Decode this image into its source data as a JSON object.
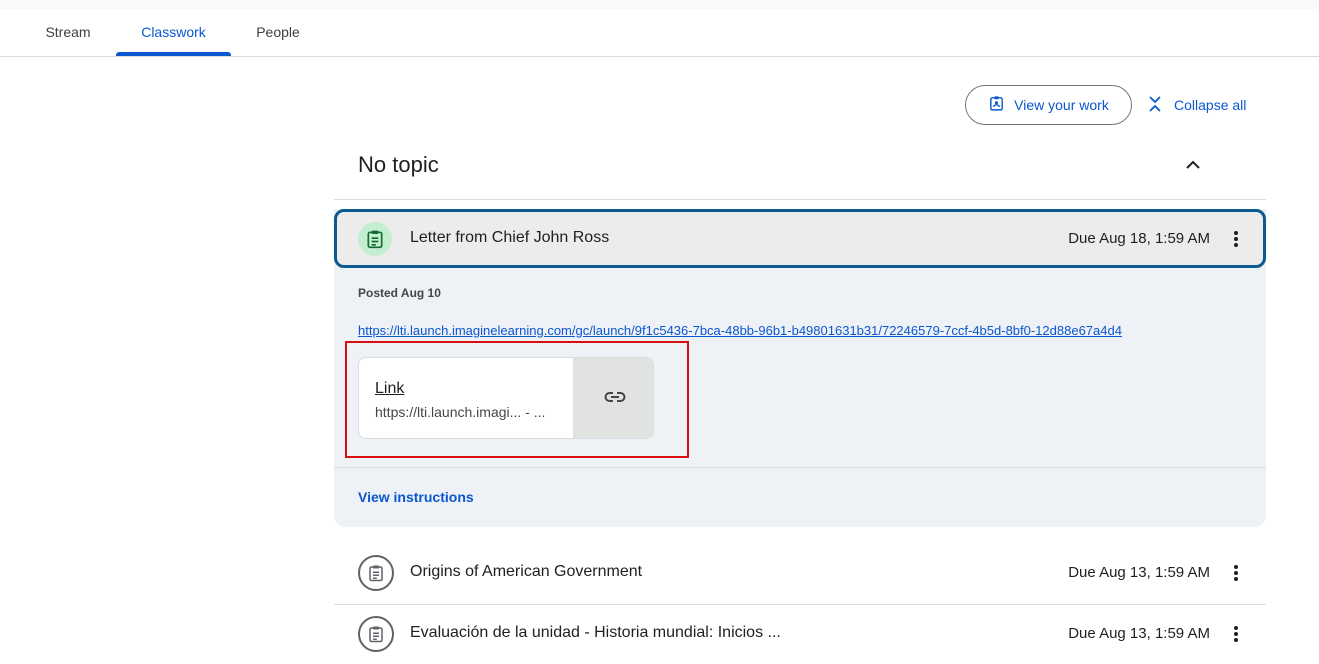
{
  "tabs": [
    {
      "label": "Stream",
      "active": false
    },
    {
      "label": "Classwork",
      "active": true
    },
    {
      "label": "People",
      "active": false
    }
  ],
  "toolbar": {
    "view_your_work": "View your work",
    "collapse_all": "Collapse all"
  },
  "topic": {
    "title": "No topic"
  },
  "expanded_item": {
    "title": "Letter from Chief John Ross",
    "due": "Due Aug 18, 1:59 AM",
    "posted": "Posted Aug 10",
    "url": "https://lti.launch.imaginelearning.com/gc/launch/9f1c5436-7bca-48bb-96b1-b49801631b31/72246579-7ccf-4b5d-8bf0-12d88e67a4d4",
    "attachment": {
      "title": "Link",
      "subtitle": "https://lti.launch.imagi... - ..."
    },
    "view_instructions": "View instructions"
  },
  "items": [
    {
      "title": "Origins of American Government",
      "due": "Due Aug 13, 1:59 AM"
    },
    {
      "title": "Evaluación de la unidad - Historia mundial: Inicios ...",
      "due": "Due Aug 13, 1:59 AM"
    }
  ],
  "colors": {
    "accent": "#0b57d0",
    "selected_border": "#0b5a8f",
    "highlight": "#d90f0f",
    "assignment_icon_bg": "#c4eed0",
    "assignment_icon_fg": "#146c2e"
  }
}
